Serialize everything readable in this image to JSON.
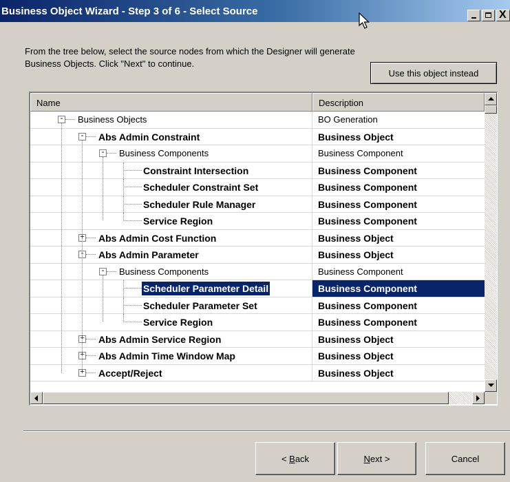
{
  "window": {
    "title": "Business Object Wizard - Step 3 of 6 - Select Source",
    "close_symbol": "X"
  },
  "instructions": {
    "line1": "From the tree below, select the source nodes from which the Designer will generate",
    "line2": "Business Objects. Click \"Next\" to continue."
  },
  "use_object_button": "Use this object instead",
  "columns": {
    "name": "Name",
    "description": "Description"
  },
  "rows": [
    {
      "name": "Business Objects",
      "description": "BO Generation"
    },
    {
      "name": "Abs Admin Constraint",
      "description": "Business Object"
    },
    {
      "name": "Business Components",
      "description": "Business Component"
    },
    {
      "name": "Constraint Intersection",
      "description": "Business Component"
    },
    {
      "name": "Scheduler Constraint Set",
      "description": "Business Component"
    },
    {
      "name": "Scheduler Rule Manager",
      "description": "Business Component"
    },
    {
      "name": "Service Region",
      "description": "Business Component"
    },
    {
      "name": "Abs Admin Cost Function",
      "description": "Business Object"
    },
    {
      "name": "Abs Admin Parameter",
      "description": "Business Object"
    },
    {
      "name": "Business Components",
      "description": "Business Component"
    },
    {
      "name": "Scheduler Parameter Detail",
      "description": "Business Component"
    },
    {
      "name": "Scheduler Parameter Set",
      "description": "Business Component"
    },
    {
      "name": "Service Region",
      "description": "Business Component"
    },
    {
      "name": "Abs Admin Service Region",
      "description": "Business Object"
    },
    {
      "name": "Abs Admin Time Window Map",
      "description": "Business Object"
    },
    {
      "name": "Accept/Reject",
      "description": "Business Object"
    }
  ],
  "selected_row": 10,
  "buttons": {
    "back_underlined": "B",
    "back_rest": "ack",
    "back_prefix": "< ",
    "next_underlined": "N",
    "next_rest": "ext >",
    "cancel": "Cancel"
  },
  "colors": {
    "selection": "#0a246a",
    "titlebar_start": "#0a246a",
    "dialog_bg": "#d4d0c8"
  }
}
